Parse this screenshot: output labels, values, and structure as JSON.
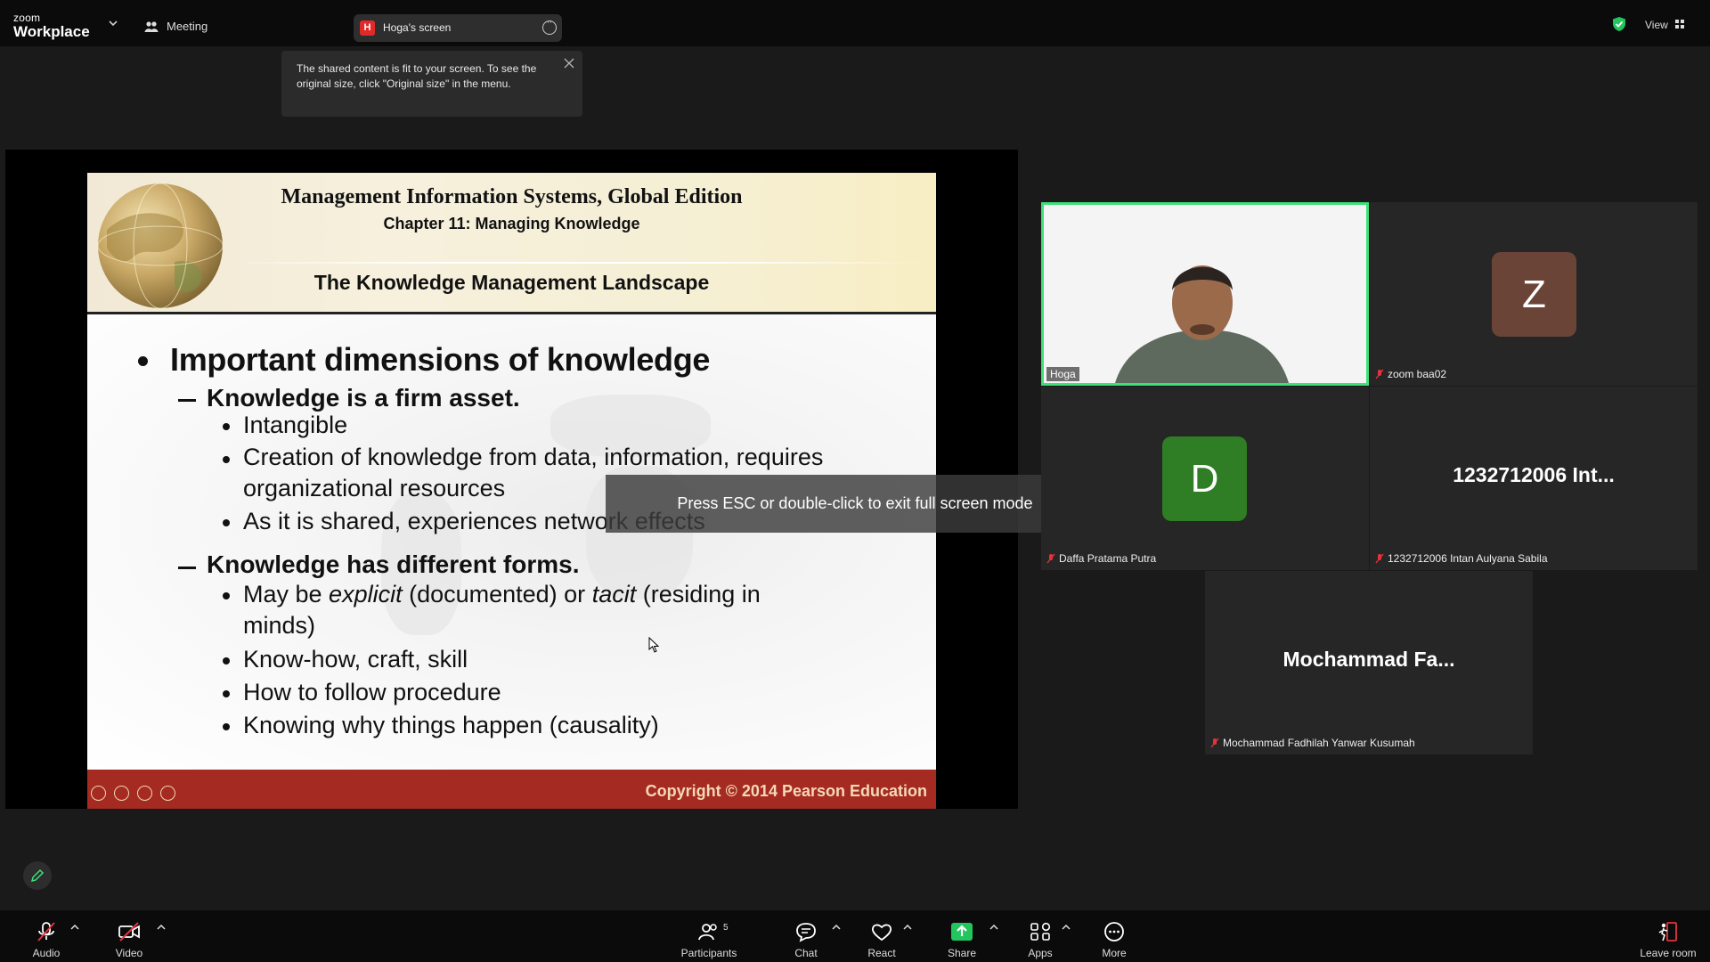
{
  "app": {
    "brand_top": "zoom",
    "brand_bottom": "Workplace"
  },
  "topbar": {
    "meeting_label": "Meeting",
    "share_badge": "H",
    "share_label": "Hoga's screen",
    "view_label": "View"
  },
  "tooltip": {
    "text": "The shared content is fit to your screen. To see the original size, click \"Original size\" in the menu."
  },
  "slide": {
    "title": "Management Information Systems, Global Edition",
    "chapter": "Chapter 11: Managing Knowledge",
    "section": "The Knowledge Management Landscape",
    "heading": "Important dimensions of knowledge",
    "sub1": "Knowledge is a firm asset.",
    "sub1_items": [
      "Intangible",
      "Creation of knowledge from data, information, requires",
      "organizational resources",
      "As it is shared, experiences network effects"
    ],
    "sub2": "Knowledge has different forms.",
    "sub2_items": {
      "explicit_pre": "May be ",
      "explicit": "explicit",
      "explicit_mid": " (documented) or ",
      "tacit": "tacit",
      "tacit_post": " (residing in",
      "minds": "minds)",
      "knowhow": "Know-how, craft, skill",
      "procedure": "How to follow procedure",
      "causality": "Knowing why things happen (causality)"
    },
    "copyright": "Copyright © 2014 Pearson Education"
  },
  "fullscreen_toast": "Press ESC or double-click to exit full screen mode",
  "participants": [
    {
      "name": "Hoga",
      "video": true
    },
    {
      "name": "zoom baa02",
      "initial": "Z",
      "avatar_color": "#6b4438"
    },
    {
      "name": "Daffa Pratama Putra",
      "initial": "D",
      "avatar_color": "#2f7d24"
    },
    {
      "name": "1232712006 Intan Aulyana Sabila",
      "display": "1232712006  Int..."
    },
    {
      "name": "Mochammad Fadhilah Yanwar Kusumah",
      "display": "Mochammad  Fa..."
    }
  ],
  "toolbar": {
    "audio": "Audio",
    "video": "Video",
    "participants": "Participants",
    "participants_count": "5",
    "chat": "Chat",
    "react": "React",
    "share": "Share",
    "apps": "Apps",
    "more": "More",
    "leave": "Leave room"
  },
  "colors": {
    "accent_green": "#3fe07a",
    "share_green": "#22c55e",
    "footer_red": "#a42a22",
    "leave_red": "#e5323b"
  },
  "icons": [
    "chevron-down-icon",
    "meeting-icon",
    "more-icon",
    "close-icon",
    "shield-icon",
    "view-grid-icon",
    "mic-off-icon",
    "video-off-icon",
    "participants-icon",
    "chat-icon",
    "heart-icon",
    "share-up-icon",
    "apps-icon",
    "more-circle-icon",
    "leave-icon",
    "pencil-icon"
  ]
}
